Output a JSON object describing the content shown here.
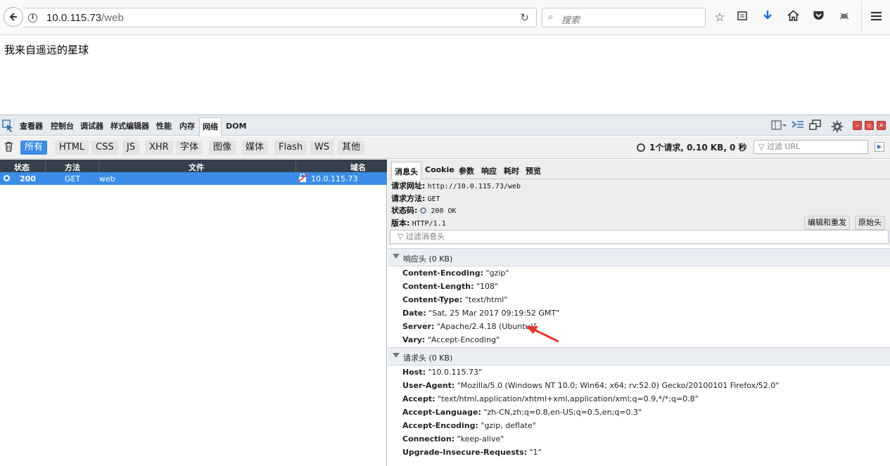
{
  "browser": {
    "url_host": "10.0.115.73",
    "url_path": "/web",
    "search_placeholder": "搜索"
  },
  "page": {
    "text": "我来自遥远的星球"
  },
  "devtools": {
    "tabs": [
      "查看器",
      "控制台",
      "调试器",
      "样式编辑器",
      "性能",
      "内存",
      "网络",
      "DOM"
    ],
    "filters": [
      "所有",
      "HTML",
      "CSS",
      "JS",
      "XHR",
      "字体",
      "图像",
      "媒体",
      "Flash",
      "WS",
      "其他"
    ],
    "summary": "1个请求, 0.10 KB, 0 秒",
    "url_filter_placeholder": "过滤 URL",
    "columns": {
      "status": "状态",
      "method": "方法",
      "file": "文件",
      "domain": "域名"
    },
    "request": {
      "status": "200",
      "method": "GET",
      "file": "web",
      "domain": "10.0.115.73"
    },
    "detail_tabs": [
      "消息头",
      "Cookie",
      "参数",
      "响应",
      "耗时",
      "预览"
    ],
    "summary_lines": {
      "url_label": "请求网址:",
      "url_value": "http://10.0.115.73/web",
      "method_label": "请求方法:",
      "method_value": "GET",
      "status_label": "状态码:",
      "status_value": "200 OK",
      "version_label": "版本:",
      "version_value": "HTTP/1.1"
    },
    "buttons": {
      "edit_resend": "编辑和重发",
      "raw_headers": "原始头"
    },
    "header_filter_placeholder": "过滤消息头",
    "response_section": "响应头 (0 KB)",
    "response_headers": [
      {
        "k": "Content-Encoding:",
        "v": " \"gzip\""
      },
      {
        "k": "Content-Length:",
        "v": " \"108\""
      },
      {
        "k": "Content-Type:",
        "v": " \"text/html\""
      },
      {
        "k": "Date:",
        "v": " \"Sat, 25 Mar 2017 09:19:52 GMT\""
      },
      {
        "k": "Server:",
        "v": " \"Apache/2.4.18 (Ubuntu)\""
      },
      {
        "k": "Vary:",
        "v": " \"Accept-Encoding\""
      }
    ],
    "request_section": "请求头 (0 KB)",
    "request_headers": [
      {
        "k": "Host:",
        "v": " \"10.0.115.73\""
      },
      {
        "k": "User-Agent:",
        "v": " \"Mozilla/5.0 (Windows NT 10.0; Win64; x64; rv:52.0) Gecko/20100101 Firefox/52.0\""
      },
      {
        "k": "Accept:",
        "v": " \"text/html,application/xhtml+xml,application/xml;q=0.9,*/*;q=0.8\""
      },
      {
        "k": "Accept-Language:",
        "v": " \"zh-CN,zh;q=0.8,en-US;q=0.5,en;q=0.3\""
      },
      {
        "k": "Accept-Encoding:",
        "v": " \"gzip, deflate\""
      },
      {
        "k": "Connection:",
        "v": " \"keep-alive\""
      },
      {
        "k": "Upgrade-Insecure-Requests:",
        "v": " \"1\""
      }
    ]
  },
  "colors": {
    "accent": "#3b8de8",
    "arrow": "#e8362b"
  }
}
